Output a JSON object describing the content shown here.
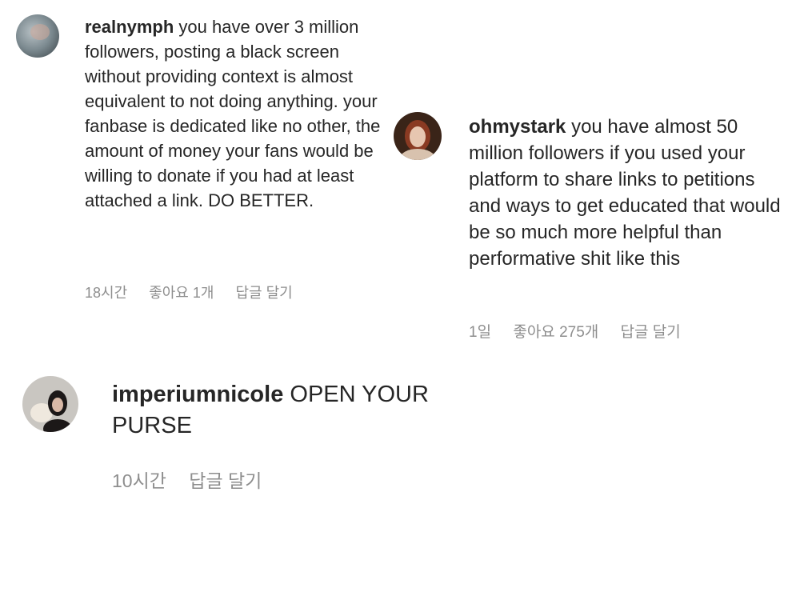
{
  "comments": [
    {
      "username": "realnymph",
      "text": "you have over 3 million followers, posting a black screen without providing context is almost equivalent to not doing anything. your fanbase is dedicated like no other, the amount of money your fans would be willing to donate if you had at least attached a link. DO BETTER.",
      "time": "18시간",
      "likes": "좋아요 1개",
      "reply": "답글 달기"
    },
    {
      "username": "ohmystark",
      "text": "you have almost 50 million followers if you used your platform to share links to petitions and ways to get educated that would be so much more helpful than performative shit like this",
      "time": "1일",
      "likes": "좋아요 275개",
      "reply": "답글 달기"
    },
    {
      "username": "imperiumnicole",
      "text": "OPEN YOUR PURSE",
      "time": "10시간",
      "reply": "답글 달기"
    }
  ],
  "colors": {
    "text": "#262626",
    "meta": "#8e8e8e",
    "background": "#ffffff"
  }
}
